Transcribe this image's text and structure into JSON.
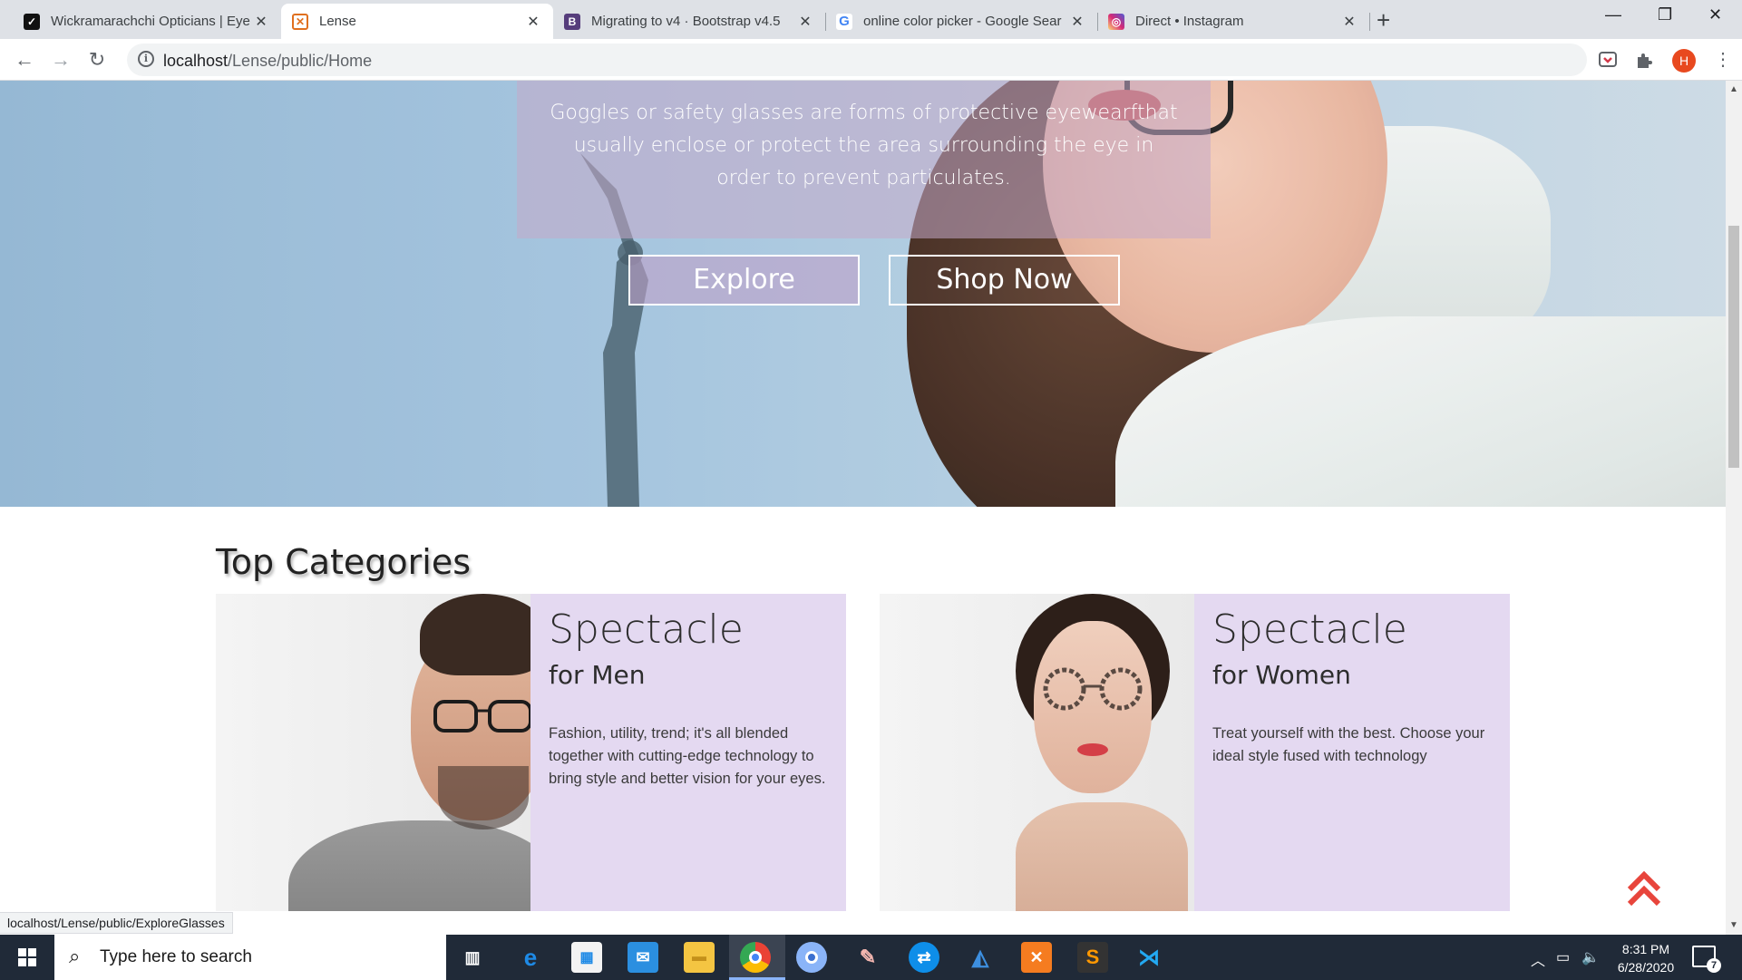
{
  "browser": {
    "tabs": [
      {
        "title": "Wickramarachchi Opticians | Eye",
        "favicon": "w-logo-icon",
        "color": "#111111"
      },
      {
        "title": "Lense",
        "favicon": "xampp-icon",
        "color": "#e0701f"
      },
      {
        "title": "Migrating to v4 · Bootstrap v4.5",
        "favicon": "bootstrap-icon",
        "color": "#563d7c"
      },
      {
        "title": "online color picker - Google Sear",
        "favicon": "google-icon",
        "color": "#4285f4"
      },
      {
        "title": "Direct • Instagram",
        "favicon": "instagram-icon",
        "color": "#d6249f"
      }
    ],
    "active_tab_index": 1,
    "url_host": "localhost",
    "url_path": "/Lense/public/Home",
    "profile_initial": "H",
    "status_url": "localhost/Lense/public/ExploreGlasses"
  },
  "hero": {
    "text": "Goggles or safety glasses are forms of protective eyewearfthat usually enclose or protect the area surrounding the eye in order to prevent particulates.",
    "explore_label": "Explore",
    "shop_label": "Shop Now"
  },
  "categories": {
    "title": "Top Categories",
    "men": {
      "title": "Spectacle",
      "subtitle": "for Men",
      "description": "Fashion, utility, trend; it's all blended together with cutting-edge technology to bring style and better vision for your eyes."
    },
    "women": {
      "title": "Spectacle",
      "subtitle": "for Women",
      "description": "Treat yourself with the best. Choose your ideal style fused with technology"
    }
  },
  "taskbar": {
    "search_placeholder": "Type here to search",
    "time": "8:31 PM",
    "date": "6/28/2020",
    "notification_count": "7"
  },
  "colors": {
    "card_bg": "#e4d9f1",
    "accent_arrow": "#e8453c",
    "taskbar_bg": "#202a38"
  }
}
